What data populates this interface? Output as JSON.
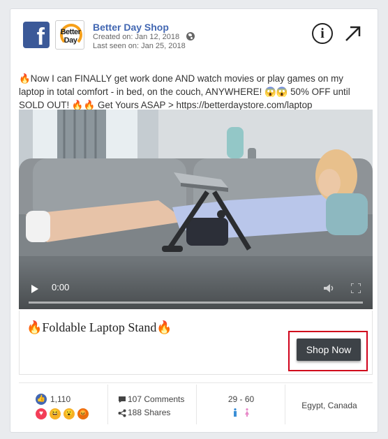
{
  "header": {
    "page_name": "Better Day Shop",
    "created": "Created on: Jan 12, 2018",
    "last_seen": "Last seen on: Jan 25, 2018",
    "shop_logo_text": "Better Day"
  },
  "post": {
    "line1": "🔥Now I can FINALLY get work done AND watch movies or play games on my",
    "line2": "laptop in total comfort - in bed, on the couch, ANYWHERE! 😱😱 50% OFF until",
    "line3": "SOLD OUT! 🔥🔥 Get Yours ASAP > https://betterdaystore.com/laptop"
  },
  "video": {
    "time": "0:00",
    "progress": 0
  },
  "cta": {
    "title": "🔥Foldable Laptop Stand🔥",
    "button_label": "Shop Now"
  },
  "stats": {
    "reactions_count": "1,110",
    "comments": "107 Comments",
    "shares": "188 Shares",
    "age_range": "29 - 60",
    "location": "Egypt, Canada"
  },
  "colors": {
    "brand_blue": "#4267b2",
    "facebook": "#3b5998",
    "highlight": "#d0021b",
    "button": "#3d4247"
  }
}
